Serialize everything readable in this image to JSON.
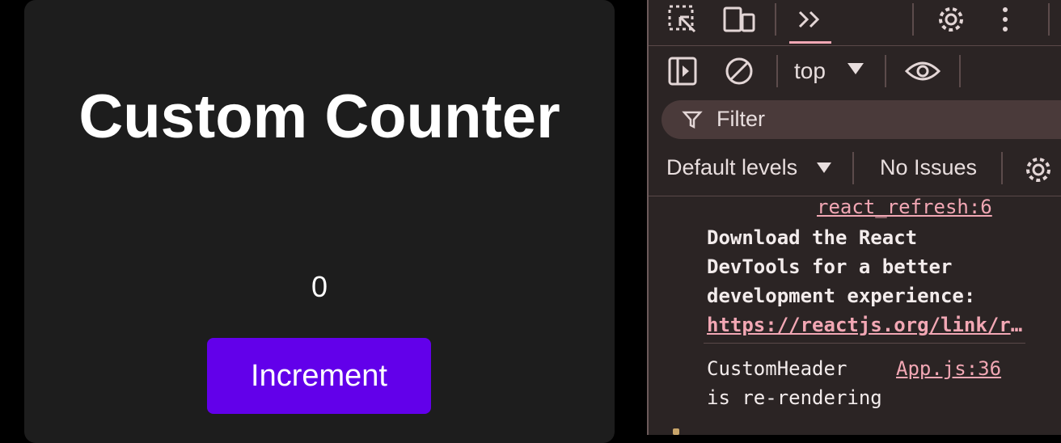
{
  "app": {
    "title": "Custom Counter",
    "count": "0",
    "increment_label": "Increment"
  },
  "devtools": {
    "toolbar_top": {
      "icons": [
        "inspect-element-icon",
        "device-toolbar-icon",
        "more-tabs-icon",
        "settings-gear-icon",
        "kebab-menu-icon"
      ]
    },
    "toolbar_console": {
      "context": "top",
      "icons": [
        "sidebar-toggle-icon",
        "clear-console-icon",
        "live-expression-eye-icon"
      ]
    },
    "filter": {
      "placeholder": "Filter"
    },
    "levels": {
      "label": "Default levels",
      "issues": "No Issues"
    },
    "messages": {
      "refresh_link": "react_refresh:6",
      "devtools_msg": [
        "Download the React",
        "DevTools for a better",
        "development experience:",
        "https://reactjs.org/link/react-devtools"
      ],
      "render_msg_text": "CustomHeader",
      "render_msg_link": "App.js:36",
      "render_msg_text2": "is re-rendering"
    },
    "colors": {
      "link": "#f2a7b4",
      "panel_bg": "#2b2424",
      "button_bg": "#6200ea"
    }
  }
}
